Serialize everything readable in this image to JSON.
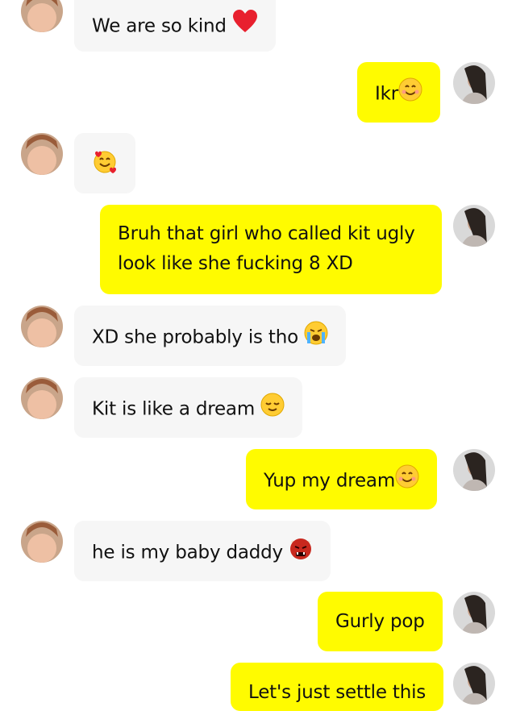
{
  "conversation": {
    "messages": [
      {
        "sender": "friend",
        "text": "We are so kind",
        "emoji": "red-heart"
      },
      {
        "sender": "me",
        "text": "Ikr",
        "emoji": "smiling-face"
      },
      {
        "sender": "friend",
        "text": "",
        "emoji": "smiling-face-with-hearts"
      },
      {
        "sender": "me",
        "text": "Bruh that girl who called kit ugly look like she fucking 8 XD"
      },
      {
        "sender": "friend",
        "text": "XD she probably is tho",
        "emoji": "crying-face"
      },
      {
        "sender": "friend",
        "text": "Kit is like a dream",
        "emoji": "relieved-face"
      },
      {
        "sender": "me",
        "text": "Yup my dream",
        "emoji": "smiling-face"
      },
      {
        "sender": "friend",
        "text": "he is my baby daddy",
        "emoji": "ogre-face"
      },
      {
        "sender": "me",
        "text": "Gurly pop"
      },
      {
        "sender": "me",
        "text": "Let's just settle this"
      }
    ]
  },
  "colors": {
    "outgoing_bubble": "#fffb00",
    "incoming_bubble": "#f6f6f6",
    "background": "#ffffff"
  }
}
